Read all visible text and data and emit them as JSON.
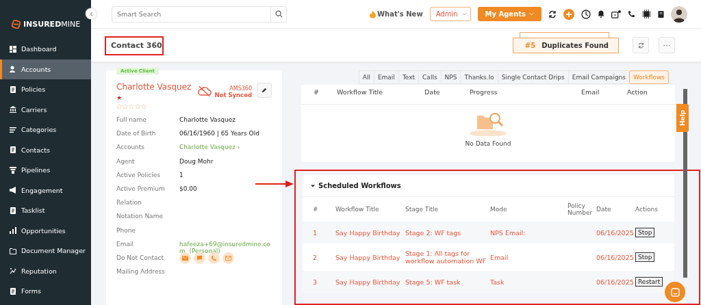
{
  "brand": {
    "name_bold": "INSURED",
    "name_light": "MINE"
  },
  "sidebar": {
    "items": [
      {
        "label": "Dashboard",
        "selected": false
      },
      {
        "label": "Accounts",
        "selected": true
      },
      {
        "label": "Policies",
        "selected": false
      },
      {
        "label": "Carriers",
        "selected": false
      },
      {
        "label": "Categories",
        "selected": false
      },
      {
        "label": "Contacts",
        "selected": false
      },
      {
        "label": "Pipelines",
        "selected": false
      },
      {
        "label": "Engagement",
        "selected": false
      },
      {
        "label": "Tasklist",
        "selected": false
      },
      {
        "label": "Opportunities",
        "selected": false
      },
      {
        "label": "Document Manager",
        "selected": false
      },
      {
        "label": "Reputation",
        "selected": false
      },
      {
        "label": "Forms",
        "selected": false
      }
    ]
  },
  "topbar": {
    "search": {
      "placeholder": "Smart Search"
    },
    "whats_new": "What's New",
    "role": "Admin",
    "agents_button": "My Agents"
  },
  "header": {
    "title": "Contact 360",
    "duplicates": {
      "count": "#5",
      "label": "Duplicates Found"
    }
  },
  "contact": {
    "status": "Active Client",
    "name": "Charlotte Vasquez",
    "required_mark": "★",
    "stars": 0,
    "sync_system": "AMS360",
    "sync_status": "Not Synced",
    "fields": [
      {
        "label": "Full name",
        "value": "Charlotte Vasquez",
        "kind": "text"
      },
      {
        "label": "Date of Birth",
        "value": "06/16/1960 | 65 Years Old",
        "kind": "text"
      },
      {
        "label": "Accounts",
        "value": "Charlotte Vasquez ›",
        "kind": "link"
      },
      {
        "label": "Agent",
        "value": "Doug Mohr",
        "kind": "text"
      },
      {
        "label": "Active Policies",
        "value": "1",
        "kind": "text"
      },
      {
        "label": "Active Premium",
        "value": "$0.00",
        "kind": "text"
      },
      {
        "label": "Relation",
        "kind": "text"
      },
      {
        "label": "Notation Name",
        "kind": "text"
      },
      {
        "label": "Phone",
        "kind": "text"
      },
      {
        "label": "Email",
        "value": "hafeeza+69@insuredmine.com  (Personal)",
        "kind": "link"
      },
      {
        "label": "Do Not Contact",
        "kind": "channels"
      },
      {
        "label": "Mailing Address",
        "kind": "text"
      }
    ]
  },
  "tabs": [
    {
      "label": "All",
      "selected": false
    },
    {
      "label": "Email",
      "selected": false
    },
    {
      "label": "Text",
      "selected": false
    },
    {
      "label": "Calls",
      "selected": false
    },
    {
      "label": "NPS",
      "selected": false
    },
    {
      "label": "Thanks.Io",
      "selected": false
    },
    {
      "label": "Single Contact Drips",
      "selected": false
    },
    {
      "label": "Email Campaigns",
      "selected": false
    },
    {
      "label": "Workflows",
      "selected": true
    }
  ],
  "workflows_table": {
    "columns": [
      "#",
      "Workflow Title",
      "Date",
      "Progress",
      "Email",
      "Action"
    ],
    "empty_text": "No Data Found"
  },
  "scheduled": {
    "title": "Scheduled Workflows",
    "expanded": true,
    "columns": [
      "#",
      "Workflow Title",
      "Stage Title",
      "Mode",
      "Policy Number",
      "Date",
      "Actions"
    ],
    "rows": [
      {
        "num": "1",
        "workflow": "Say Happy Birthday",
        "stage": "Stage 2: WF tags",
        "mode": "NPS Email:",
        "date": "06/16/2025",
        "action": "Stop"
      },
      {
        "num": "2",
        "workflow": "Say Happy Birthday",
        "stage": "Stage 1: All tags for workflow automation WF",
        "mode": "Email",
        "date": "06/16/2025",
        "action": "Stop"
      },
      {
        "num": "3",
        "workflow": "Say Happy Birthday",
        "stage": "Stage 5: WF task",
        "mode": "Task",
        "date": "06/16/2025",
        "action": "Restart"
      }
    ]
  },
  "help_tab": "Help"
}
